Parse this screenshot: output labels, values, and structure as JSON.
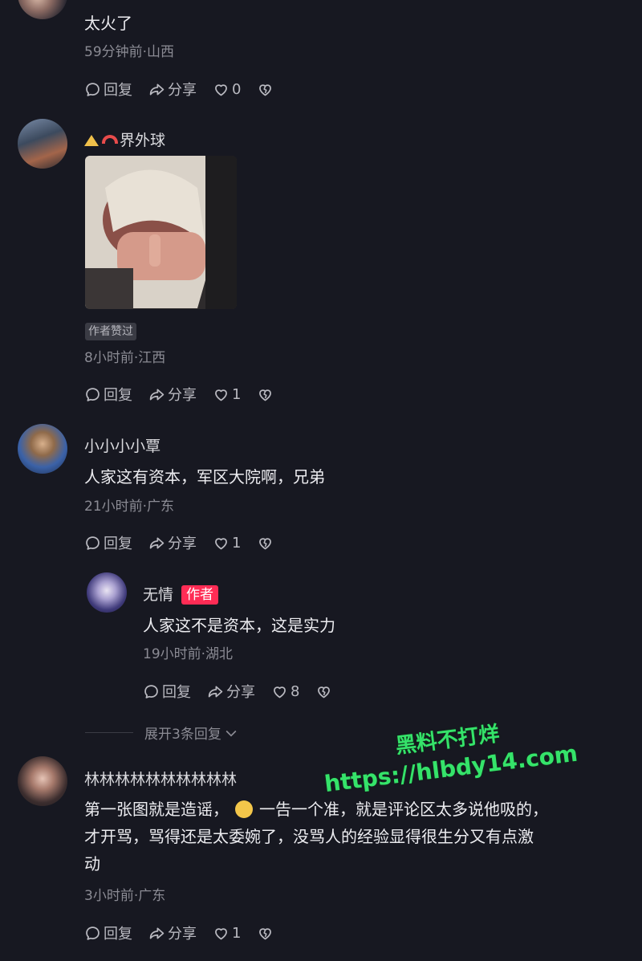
{
  "comments": [
    {
      "text": "太火了",
      "meta": "59分钟前·山西",
      "reply": "回复",
      "share": "分享",
      "likes": "0"
    },
    {
      "username": "界外球",
      "tag": "作者赞过",
      "meta": "8小时前·江西",
      "reply": "回复",
      "share": "分享",
      "likes": "1"
    },
    {
      "username": "小小小小覃",
      "text": "人家这有资本，军区大院啊，兄弟",
      "meta": "21小时前·广东",
      "reply": "回复",
      "share": "分享",
      "likes": "1"
    },
    {
      "username": "无情",
      "badge": "作者",
      "text": "人家这不是资本，这是实力",
      "meta": "19小时前·湖北",
      "reply": "回复",
      "share": "分享",
      "likes": "8"
    },
    {
      "username": "林林林林林林林林林林",
      "text_a": "第一张图就是造谣，",
      "text_b": "一告一个准，就是评论区太多说他吸的，",
      "text_c": "才开骂，骂得还是太委婉了，没骂人的经验显得很生分又有点激",
      "text_d": "动",
      "meta": "3小时前·广东",
      "reply": "回复",
      "share": "分享",
      "likes": "1"
    }
  ],
  "expand_replies": "展开3条回复",
  "watermark": {
    "line1": "黑料不打烊",
    "line2": "https://hlbdy14.com"
  },
  "colors": {
    "background": "#171821",
    "author_badge": "#ff2c55",
    "watermark": "#35e36a"
  }
}
